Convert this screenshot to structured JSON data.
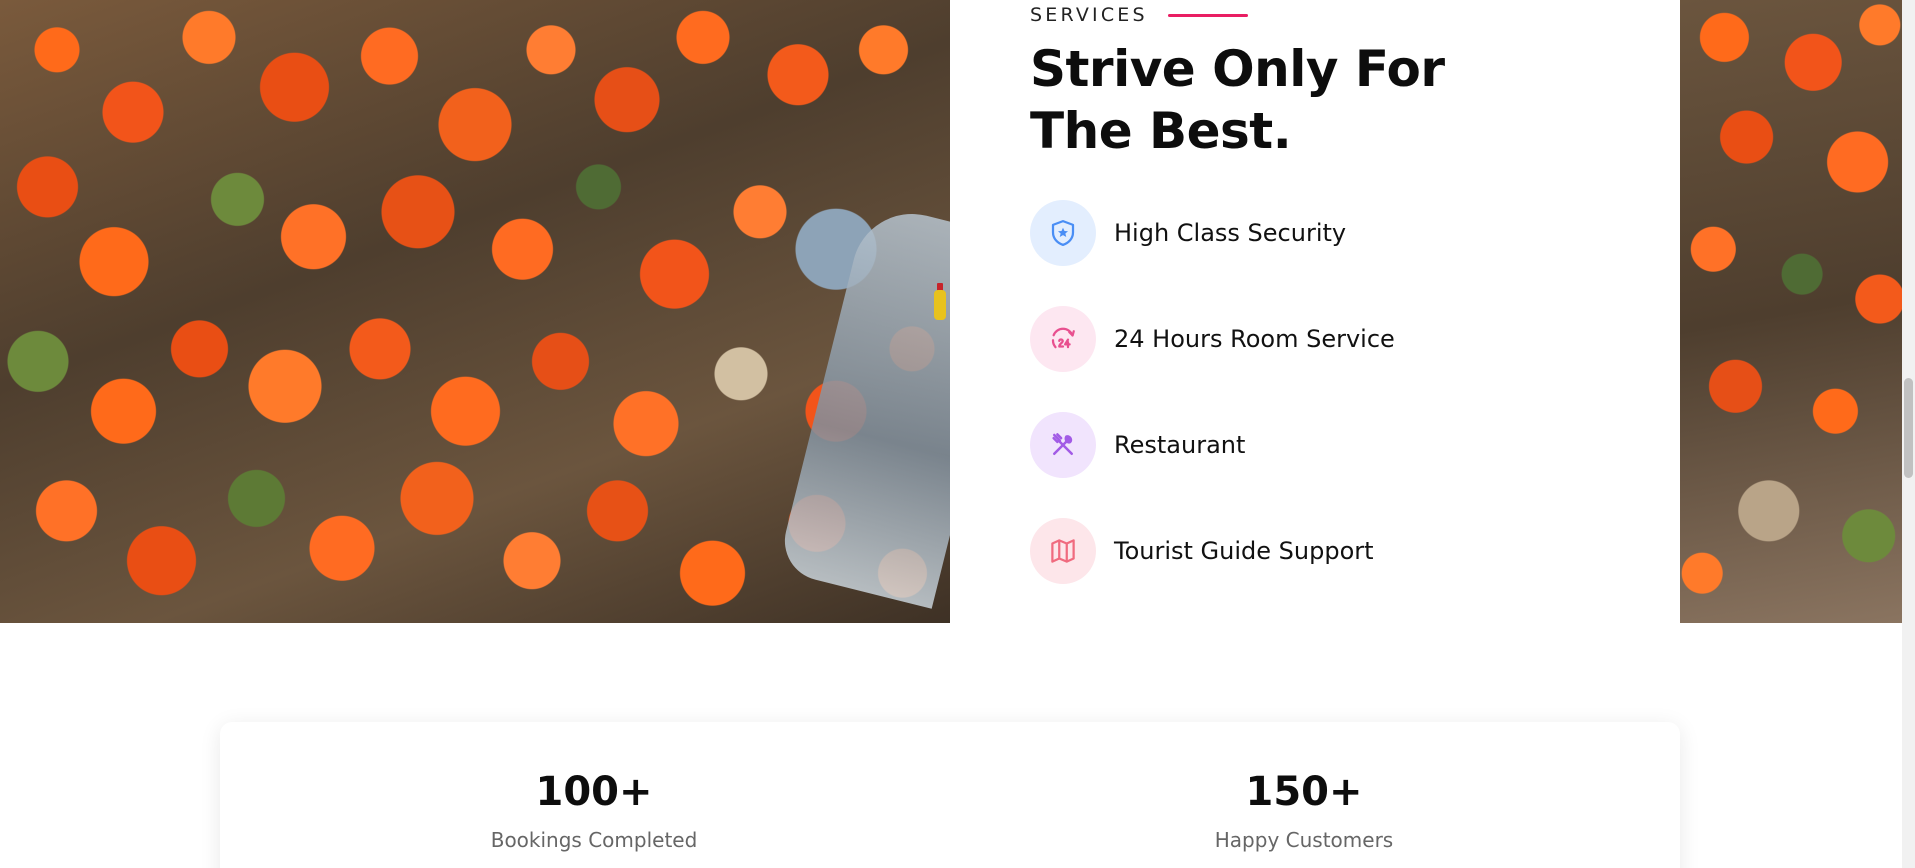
{
  "services": {
    "eyebrow": "SERVICES",
    "title": "Strive Only For The Best.",
    "accent_color": "#e91e63",
    "features": [
      {
        "label": "High Class Security",
        "icon": "shield-star-icon",
        "bg": "#e3eefe",
        "color": "#4a8ef5"
      },
      {
        "label": "24 Hours Room Service",
        "icon": "24-hours-icon",
        "bg": "#fde7f1",
        "color": "#e8508f"
      },
      {
        "label": "Restaurant",
        "icon": "utensils-icon",
        "bg": "#f1e4fd",
        "color": "#a25be6"
      },
      {
        "label": "Tourist Guide Support",
        "icon": "map-icon",
        "bg": "#fde6ea",
        "color": "#f06b7f"
      }
    ]
  },
  "photos": {
    "left": {
      "subject": "red-flowering-trees-photo"
    },
    "right": {
      "subject": "red-flowering-trees-photo"
    }
  },
  "stats": [
    {
      "value": "100+",
      "label": "Bookings Completed"
    },
    {
      "value": "150+",
      "label": "Happy Customers"
    }
  ]
}
